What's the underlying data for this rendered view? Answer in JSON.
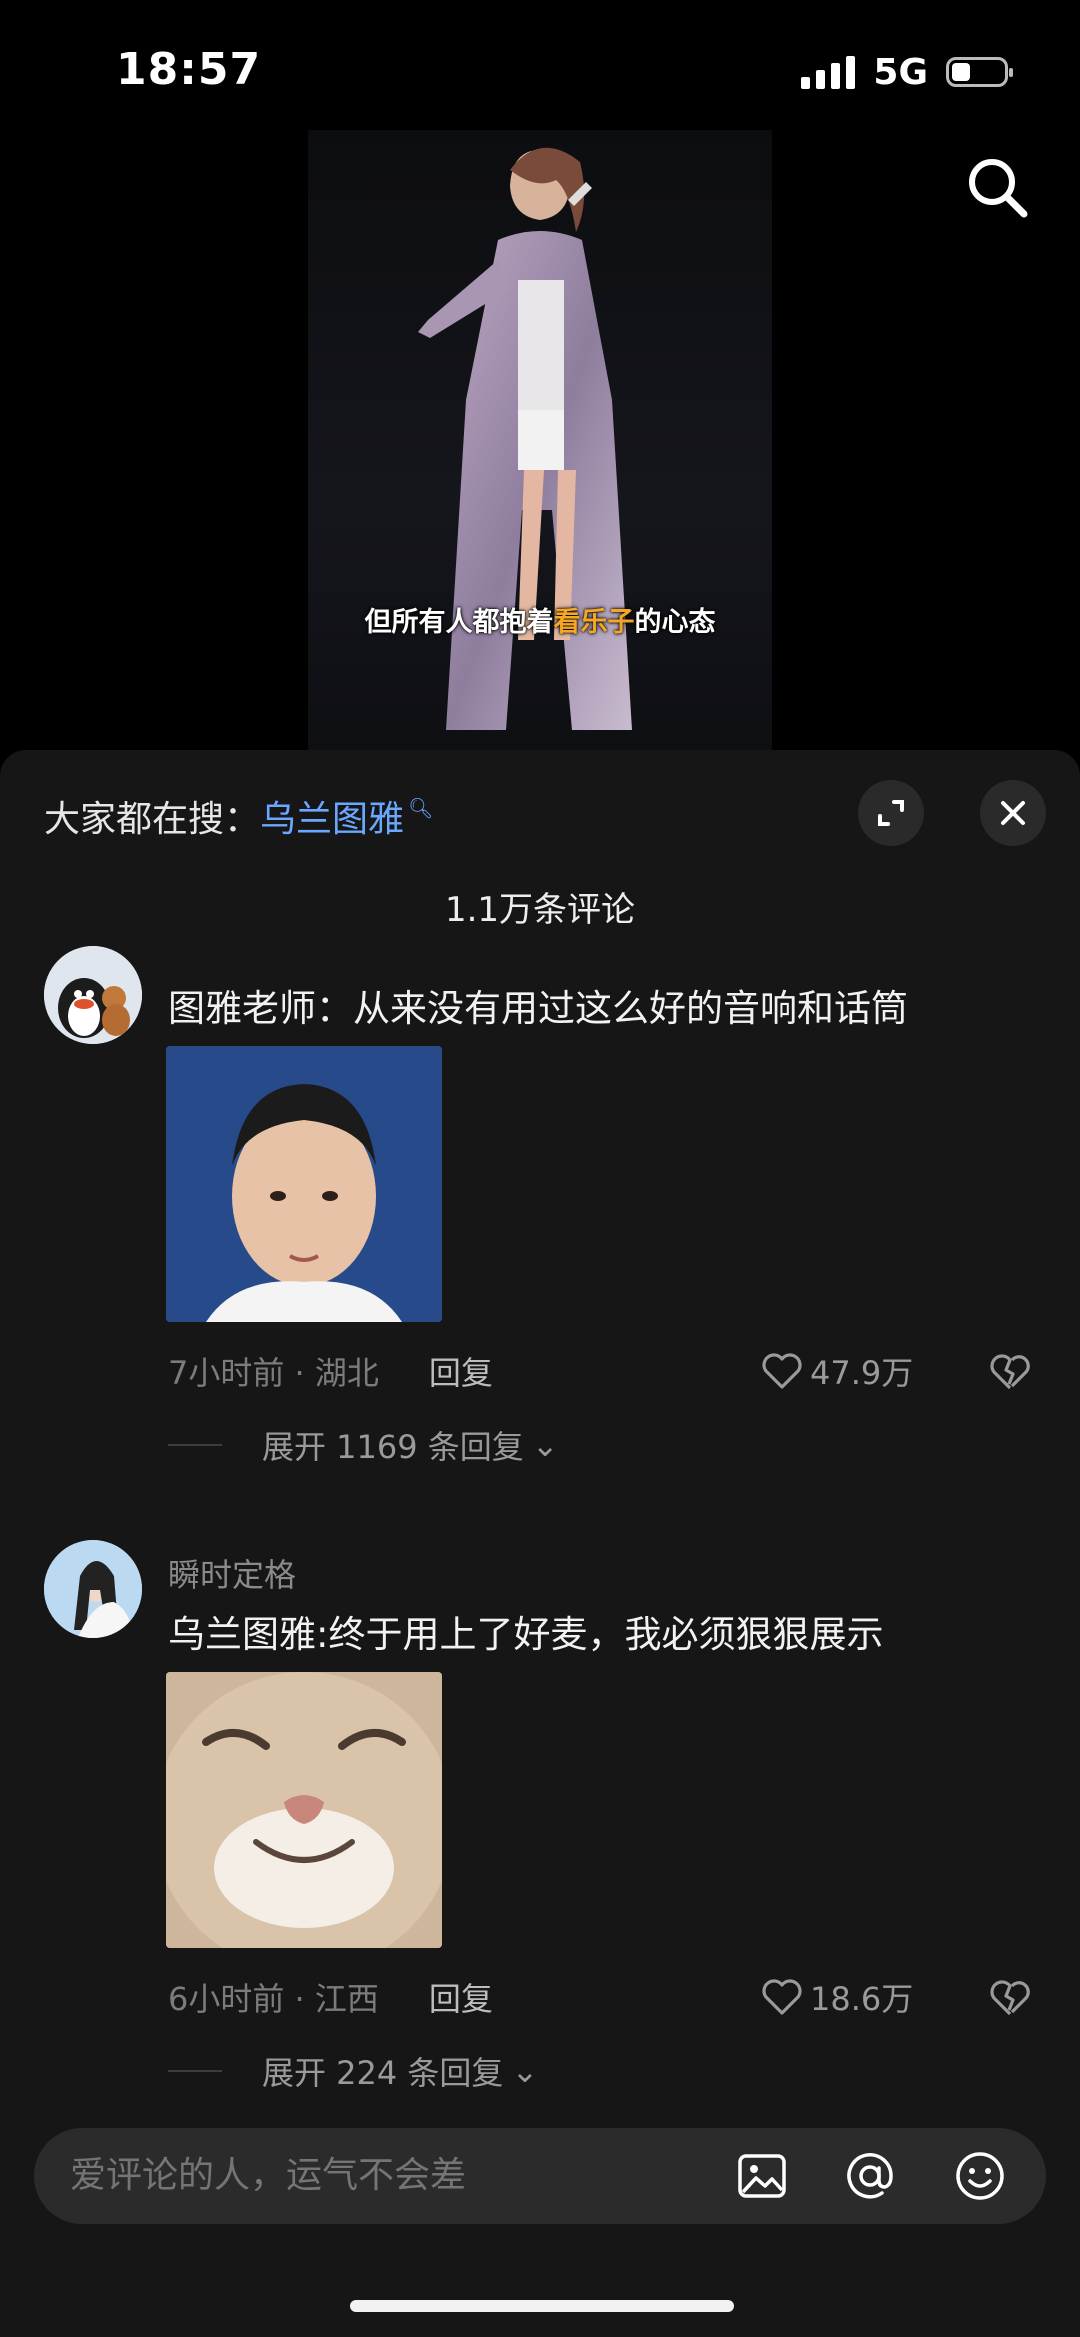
{
  "status_bar": {
    "time": "18:57",
    "network": "5G",
    "battery_level": 0.35
  },
  "video": {
    "subtitle_before": "但所有人都抱着",
    "subtitle_highlight": "看乐子",
    "subtitle_after": "的心态",
    "highlight_color": "#f5a623"
  },
  "comments_panel": {
    "hot_search_prefix": "大家都在搜：",
    "hot_search_term": "乌兰图雅",
    "comment_count": "1.1万条评论"
  },
  "comments": [
    {
      "text": "图雅老师：从来没有用过这么好的音响和话筒",
      "meta": "7小时前 · 湖北",
      "reply_label": "回复",
      "likes": "47.9万",
      "expand_label": "展开 1169 条回复"
    },
    {
      "username": "瞬时定格",
      "text": "乌兰图雅:终于用上了好麦，我必须狠狠展示",
      "meta": "6小时前 · 江西",
      "reply_label": "回复",
      "likes": "18.6万",
      "expand_label": "展开 224 条回复"
    }
  ],
  "input": {
    "placeholder": "爱评论的人，运气不会差"
  },
  "colors": {
    "accent_link": "#6aa7ff",
    "sheet_bg": "#161616",
    "input_bg": "#2b2b2b"
  }
}
